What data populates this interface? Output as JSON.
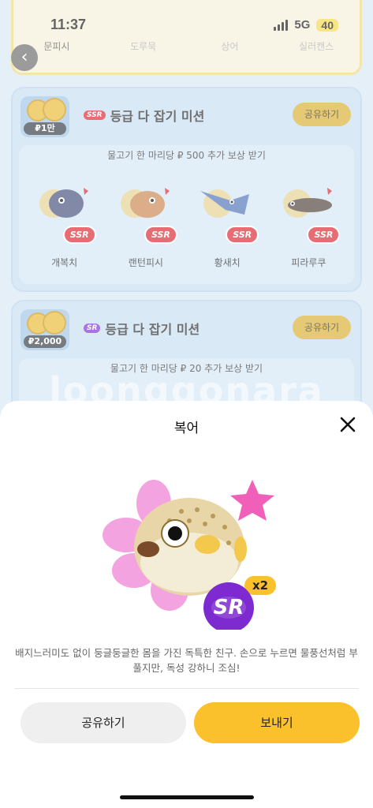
{
  "status": {
    "time": "11:37",
    "network": "5G",
    "battery": "40"
  },
  "top_tabs": [
    "문피시",
    "도루묵",
    "상어",
    "실러캔스"
  ],
  "missions": [
    {
      "tier": "SSR",
      "title": "등급 다 잡기 미션",
      "coin_label": "₽1만",
      "share_label": "공유하기",
      "reward": "물고기 한 마리당 ₽ 500 추가 보상 받기",
      "fish": [
        {
          "name": "개복치",
          "tier": "SSR"
        },
        {
          "name": "랜턴피시",
          "tier": "SSR"
        },
        {
          "name": "황새치",
          "tier": "SSR"
        },
        {
          "name": "피라루쿠",
          "tier": "SSR"
        }
      ]
    },
    {
      "tier": "SR",
      "title": "등급 다 잡기 미션",
      "coin_label": "₽2,000",
      "share_label": "공유하기",
      "reward": "물고기 한 마리당 ₽ 20 추가 보상 받기",
      "watermark": "loonggonara"
    }
  ],
  "sheet": {
    "title": "복어",
    "tier": "SR",
    "count": "x2",
    "description": "배지느러미도 없이 둥글둥글한 몸을 가진 독특한 친구. 손으로 누르면 물풍선처럼 부풀지만, 독성 강하니 조심!",
    "share_button": "공유하기",
    "send_button": "보내기"
  },
  "colors": {
    "accent": "#fbc12c",
    "ssr": "#d9202a",
    "sr": "#7d2ad0"
  }
}
